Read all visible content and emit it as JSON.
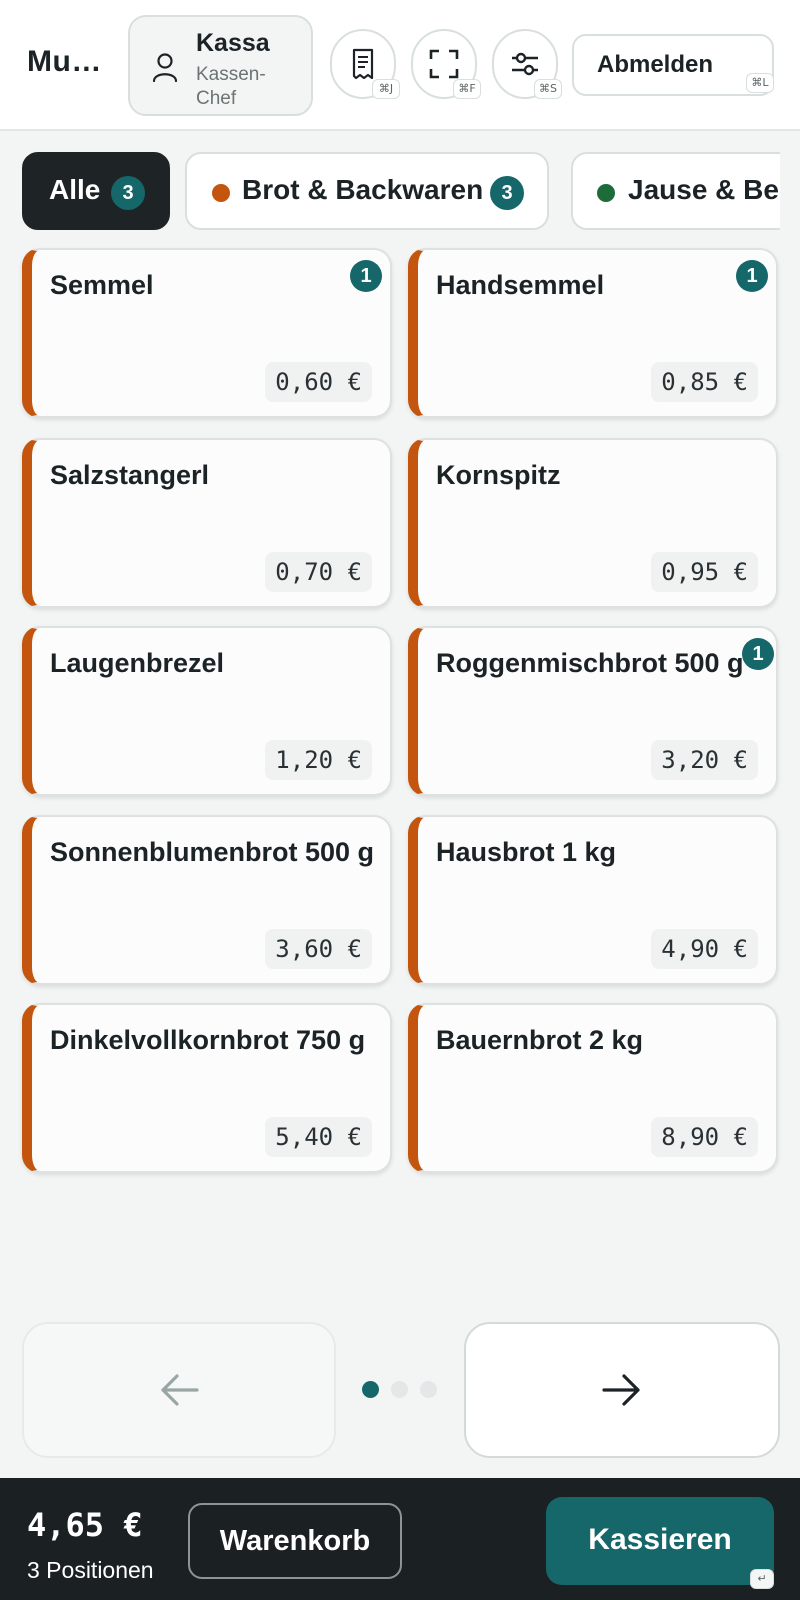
{
  "header": {
    "app_title": "Mu…",
    "user": {
      "role": "Kassa",
      "title": "Kassen-Chef"
    },
    "buttons": [
      {
        "icon": "receipt-icon",
        "shortcut": "⌘J"
      },
      {
        "icon": "fullscreen-icon",
        "shortcut": "⌘F"
      },
      {
        "icon": "settings-sliders-icon",
        "shortcut": "⌘S"
      }
    ],
    "logout": {
      "label": "Abmelden",
      "shortcut": "⌘L"
    }
  },
  "categories": [
    {
      "label": "Alle",
      "count": "3",
      "active": true
    },
    {
      "label": "Brot & Backwaren",
      "count": "3",
      "dot_color": "#c4550f"
    },
    {
      "label": "Jause & Be",
      "dot_color": "#1e6b3a"
    }
  ],
  "products": [
    {
      "name": "Semmel",
      "price": "0,60 €",
      "qty": "1"
    },
    {
      "name": "Handsemmel",
      "price": "0,85 €",
      "qty": "1"
    },
    {
      "name": "Salzstangerl",
      "price": "0,70 €"
    },
    {
      "name": "Kornspitz",
      "price": "0,95 €"
    },
    {
      "name": "Laugenbrezel",
      "price": "1,20 €"
    },
    {
      "name": "Roggenmischbrot 500 g",
      "price": "3,20 €",
      "qty": "1"
    },
    {
      "name": "Sonnenblumenbrot 500 g",
      "price": "3,60 €"
    },
    {
      "name": "Hausbrot 1 kg",
      "price": "4,90 €"
    },
    {
      "name": "Dinkelvollkornbrot 750 g",
      "price": "5,40 €"
    },
    {
      "name": "Bauernbrot 2 kg",
      "price": "8,90 €"
    }
  ],
  "pagination": {
    "current_page": 1,
    "total_pages": 3
  },
  "footer": {
    "total": "4,65 €",
    "positions": "3 Positionen",
    "cart_label": "Warenkorb",
    "checkout_label": "Kassieren",
    "checkout_shortcut": "↵"
  },
  "colors": {
    "accent": "#15676a",
    "bakery": "#c4550f",
    "snacks": "#1e6b3a",
    "dark": "#1b2022"
  }
}
